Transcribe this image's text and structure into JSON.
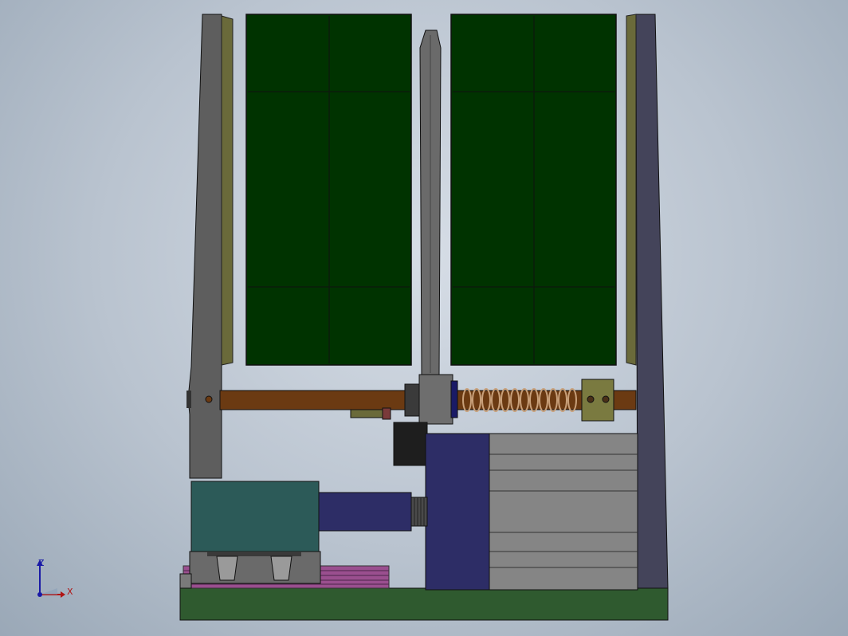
{
  "viewport": {
    "background_top": "#d6dde6",
    "background_bottom": "#9aa8b7"
  },
  "model": {
    "panel_color": "#003300",
    "frame_color": "#5a5a5a",
    "rail_color": "#6a6a3a",
    "shaft_color": "#6b3a12",
    "spring_color": "#8b4a1c",
    "motor_color": "#2d2d66",
    "gearbox_color": "#2c5a58",
    "base_color": "#2f5a2f",
    "cylinder_color": "#8a8a8a",
    "rack_color": "#9a4f8f"
  },
  "triad": {
    "z_label": "Z",
    "x_label": "X",
    "z_color": "#1a1aa6",
    "x_color": "#b01515"
  }
}
